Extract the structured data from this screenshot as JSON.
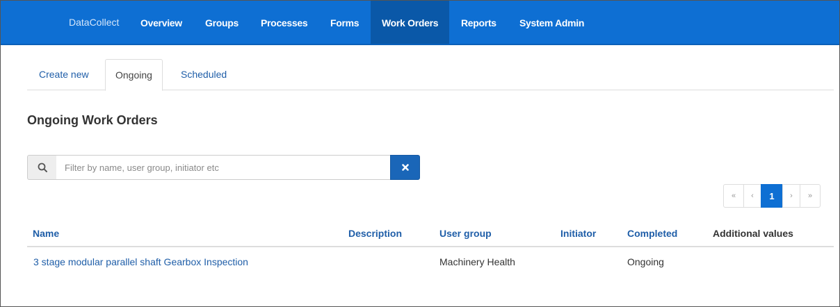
{
  "navbar": {
    "brand": "DataCollect",
    "items": [
      {
        "label": "Overview"
      },
      {
        "label": "Groups"
      },
      {
        "label": "Processes"
      },
      {
        "label": "Forms"
      },
      {
        "label": "Work Orders",
        "active": true
      },
      {
        "label": "Reports"
      },
      {
        "label": "System Admin"
      }
    ]
  },
  "tabs": [
    {
      "label": "Create new"
    },
    {
      "label": "Ongoing",
      "active": true
    },
    {
      "label": "Scheduled"
    }
  ],
  "page_title": "Ongoing Work Orders",
  "search": {
    "icon": "search-icon",
    "placeholder": "Filter by name, user group, initiator etc",
    "value": "",
    "clear_icon": "close-icon"
  },
  "pagination": {
    "first": "«",
    "prev": "‹",
    "current": "1",
    "next": "›",
    "last": "»"
  },
  "table": {
    "columns": [
      "Name",
      "Description",
      "User group",
      "Initiator",
      "Completed",
      "Additional values"
    ],
    "rows": [
      {
        "name": "3 stage modular parallel shaft Gearbox Inspection",
        "description": "",
        "user_group": "Machinery Health",
        "initiator": "",
        "completed": "Ongoing",
        "additional_values": ""
      }
    ]
  },
  "colors": {
    "navbar": "#0e6fd3",
    "navbar_active": "#0a58a8",
    "link": "#1f5ea8",
    "clear_button": "#1a66b8"
  }
}
